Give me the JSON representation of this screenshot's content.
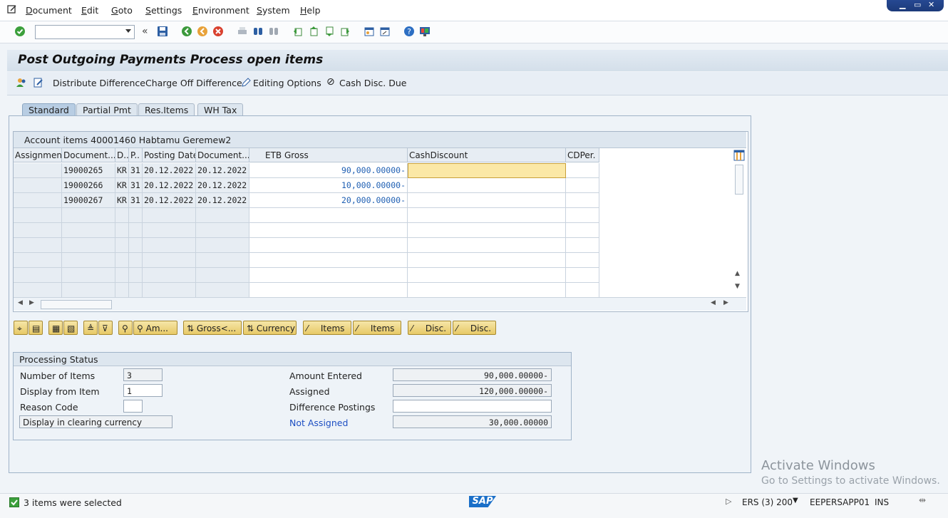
{
  "menu": {
    "items": [
      "Document",
      "Edit",
      "Goto",
      "Settings",
      "Environment",
      "System",
      "Help"
    ]
  },
  "toolbar": {
    "command_field_value": "",
    "icons": [
      "enter-icon",
      "save-icon",
      "back-icon",
      "exit-icon",
      "cancel-icon",
      "print-icon",
      "find-icon",
      "find-next-icon",
      "first-page-icon",
      "previous-page-icon",
      "next-page-icon",
      "last-page-icon",
      "create-session-icon",
      "shortcut-icon",
      "help-icon",
      "customize-layout-icon"
    ]
  },
  "title": "Post Outgoing Payments Process open items",
  "app_toolbar": {
    "distribute_difference": "Distribute Difference",
    "charge_off_difference": "Charge Off Difference",
    "editing_options": "Editing Options",
    "cash_disc_due": "Cash Disc. Due"
  },
  "tabs": [
    {
      "label": "Standard",
      "active": true
    },
    {
      "label": "Partial Pmt",
      "active": false
    },
    {
      "label": "Res.Items",
      "active": false
    },
    {
      "label": "WH Tax",
      "active": false
    }
  ],
  "table": {
    "title": "Account items 40001460 Habtamu Geremew2",
    "headers": {
      "assignment": "Assignment",
      "document_no": "Document...",
      "doc_type": "D..",
      "posting_key": "P..",
      "posting_date": "Posting Date",
      "document_date": "Document...",
      "gross": "ETB Gross",
      "cash_discount": "CashDiscount",
      "cd_per": "CDPer."
    },
    "rows": [
      {
        "assignment": "",
        "document_no": "19000265",
        "doc_type": "KR",
        "posting_key": "31",
        "posting_date": "20.12.2022",
        "document_date": "20.12.2022",
        "gross": "90,000.00000-",
        "cash_discount": "",
        "cd_per": ""
      },
      {
        "assignment": "",
        "document_no": "19000266",
        "doc_type": "KR",
        "posting_key": "31",
        "posting_date": "20.12.2022",
        "document_date": "20.12.2022",
        "gross": "10,000.00000-",
        "cash_discount": "",
        "cd_per": ""
      },
      {
        "assignment": "",
        "document_no": "19000267",
        "doc_type": "KR",
        "posting_key": "31",
        "posting_date": "20.12.2022",
        "document_date": "20.12.2022",
        "gross": "20,000.00000-",
        "cash_discount": "",
        "cd_per": ""
      }
    ]
  },
  "buttons": {
    "am": "Am...",
    "gross": "Gross<...",
    "currency": "Currency",
    "items1": "Items",
    "items2": "Items",
    "disc1": "Disc.",
    "disc2": "Disc."
  },
  "processing_status": {
    "title": "Processing Status",
    "number_of_items_label": "Number of Items",
    "number_of_items": "3",
    "display_from_item_label": "Display from Item",
    "display_from_item": "1",
    "reason_code_label": "Reason Code",
    "reason_code": "",
    "display_clearing_currency": "Display in clearing currency",
    "amount_entered_label": "Amount Entered",
    "amount_entered": "90,000.00000-",
    "assigned_label": "Assigned",
    "assigned": "120,000.00000-",
    "difference_postings_label": "Difference Postings",
    "difference_postings": "",
    "not_assigned_label": "Not Assigned",
    "not_assigned": "30,000.00000"
  },
  "status_bar": {
    "message": "3 items were selected",
    "logo": "SAP",
    "system": "ERS (3) 200",
    "server": "EEPERSAPP01",
    "mode": "INS"
  },
  "watermark": {
    "line1": "Activate Windows",
    "line2": "Go to Settings to activate Windows."
  },
  "colors": {
    "accent_blue": "#1e5fb3",
    "focus_cell": "#fbe8a6",
    "button_gold": "#e7c967"
  }
}
